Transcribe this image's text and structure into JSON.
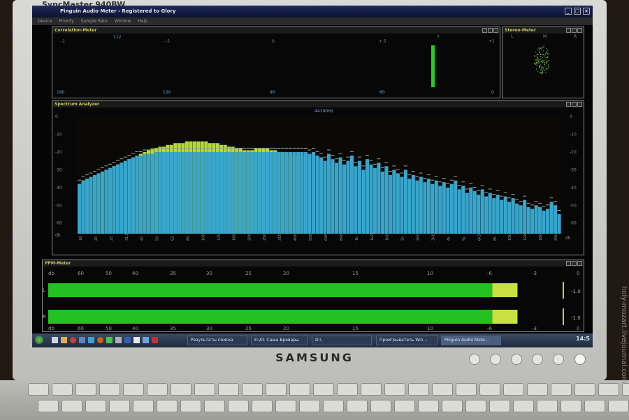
{
  "monitor": {
    "model_label": "SyncMaster 940BW",
    "brand": "SAMSUNG"
  },
  "window": {
    "title": "Pinguin Audio Meter - Registered to Glory",
    "controls": [
      "_",
      "□",
      "×"
    ]
  },
  "menu": [
    "Device",
    "Priority",
    "Sample Rate",
    "Window",
    "Help"
  ],
  "correlation": {
    "title": "Correlation-Meter",
    "top_labels": [
      "-1",
      "112",
      "-.5",
      "0",
      "+.5",
      "7",
      "+1"
    ],
    "bottom_labels": [
      "180",
      "120",
      "90",
      "60",
      "0"
    ],
    "bar_color": "#1fd01f",
    "bar_value": 0.9
  },
  "stereo": {
    "title": "Stereo-Meter",
    "labels": [
      "L",
      "M",
      "R"
    ]
  },
  "spectrum": {
    "title": "Spectrum Analyzer",
    "sample_rate": "44100Hz",
    "db_labels": [
      "0",
      "-10",
      "-20",
      "-30",
      "-40",
      "-50",
      "-60",
      "db"
    ],
    "freq_labels": [
      "16",
      "20",
      "25",
      "31,5",
      "40",
      "50",
      "63",
      "80",
      "100",
      "125",
      "160",
      "200",
      "250",
      "315",
      "400",
      "500",
      "630",
      "800",
      "1k",
      "1k25",
      "1k6",
      "2k",
      "2k5",
      "3k15",
      "4k",
      "5k",
      "6k3",
      "8k",
      "10k",
      "12k5",
      "16k",
      "20k",
      "db"
    ],
    "bar_color": "#38a6cc",
    "peak_color": "#b4dc30",
    "bars_db": [
      -38,
      -36,
      -35,
      -34,
      -33,
      -32,
      -31,
      -30,
      -29,
      -28,
      -27,
      -26,
      -25,
      -24,
      -23,
      -22,
      -22,
      -21,
      -21,
      -21,
      -20,
      -20,
      -20,
      -20,
      -20,
      -20,
      -20,
      -20,
      -20,
      -20,
      -20,
      -20,
      -20,
      -20,
      -20,
      -20,
      -20,
      -20,
      -20,
      -20,
      -20,
      -20,
      -20,
      -20,
      -20,
      -20,
      -20,
      -20,
      -20,
      -20,
      -20,
      -20,
      -20,
      -20,
      -20,
      -20,
      -20,
      -20,
      -20,
      -20,
      -21,
      -20,
      -22,
      -23,
      -25,
      -21,
      -24,
      -26,
      -23,
      -27,
      -25,
      -22,
      -28,
      -25,
      -30,
      -24,
      -27,
      -29,
      -26,
      -31,
      -28,
      -33,
      -30,
      -32,
      -34,
      -30,
      -35,
      -33,
      -36,
      -34,
      -37,
      -35,
      -38,
      -36,
      -39,
      -37,
      -40,
      -38,
      -36,
      -41,
      -39,
      -43,
      -40,
      -42,
      -44,
      -41,
      -45,
      -43,
      -46,
      -44,
      -47,
      -45,
      -48,
      -46,
      -49,
      -50,
      -47,
      -51,
      -52,
      -50,
      -51,
      -53,
      -52,
      -48,
      -50,
      -55
    ],
    "green_db": [
      -38,
      -36,
      -35,
      -34,
      -33,
      -32,
      -31,
      -30,
      -29,
      -28,
      -27,
      -26,
      -25,
      -24,
      -23,
      -22,
      -21,
      -20,
      -19,
      -18,
      -18,
      -17,
      -17,
      -16,
      -16,
      -15,
      -15,
      -15,
      -14,
      -14,
      -14,
      -14,
      -14,
      -14,
      -15,
      -15,
      -15,
      -16,
      -16,
      -17,
      -17,
      -18,
      -18,
      -19,
      -19,
      -19,
      -18,
      -18,
      -18,
      -18,
      -19,
      -19,
      -20,
      -20,
      -21,
      -21,
      -22,
      -22,
      -22,
      -22
    ]
  },
  "ppm": {
    "title": "PPM-Meter",
    "scale_top": [
      "db",
      "60",
      "50",
      "40",
      "35",
      "30",
      "25",
      "20",
      "15",
      "10",
      "-6",
      "-3",
      "0"
    ],
    "scale_bottom": [
      "db",
      "60",
      "50",
      "40",
      "35",
      "30",
      "25",
      "20",
      "15",
      "10",
      "-6",
      "-3",
      "0"
    ],
    "channels": [
      {
        "name": "L",
        "peak_label": "-1.0",
        "level": 0.93
      },
      {
        "name": "R",
        "peak_label": "-1.0",
        "level": 0.93
      }
    ],
    "green": "#22c222",
    "yellow": "#c8e040"
  },
  "taskbar": {
    "items": [
      "Результаты поиска",
      "E:\\01 Саша Бровары",
      "D:\\",
      "Проигрыватель Win...",
      "Pinguin Audio Mete..."
    ],
    "clock": "14:5"
  },
  "watermark": "holy-mozart.livejournal.com"
}
